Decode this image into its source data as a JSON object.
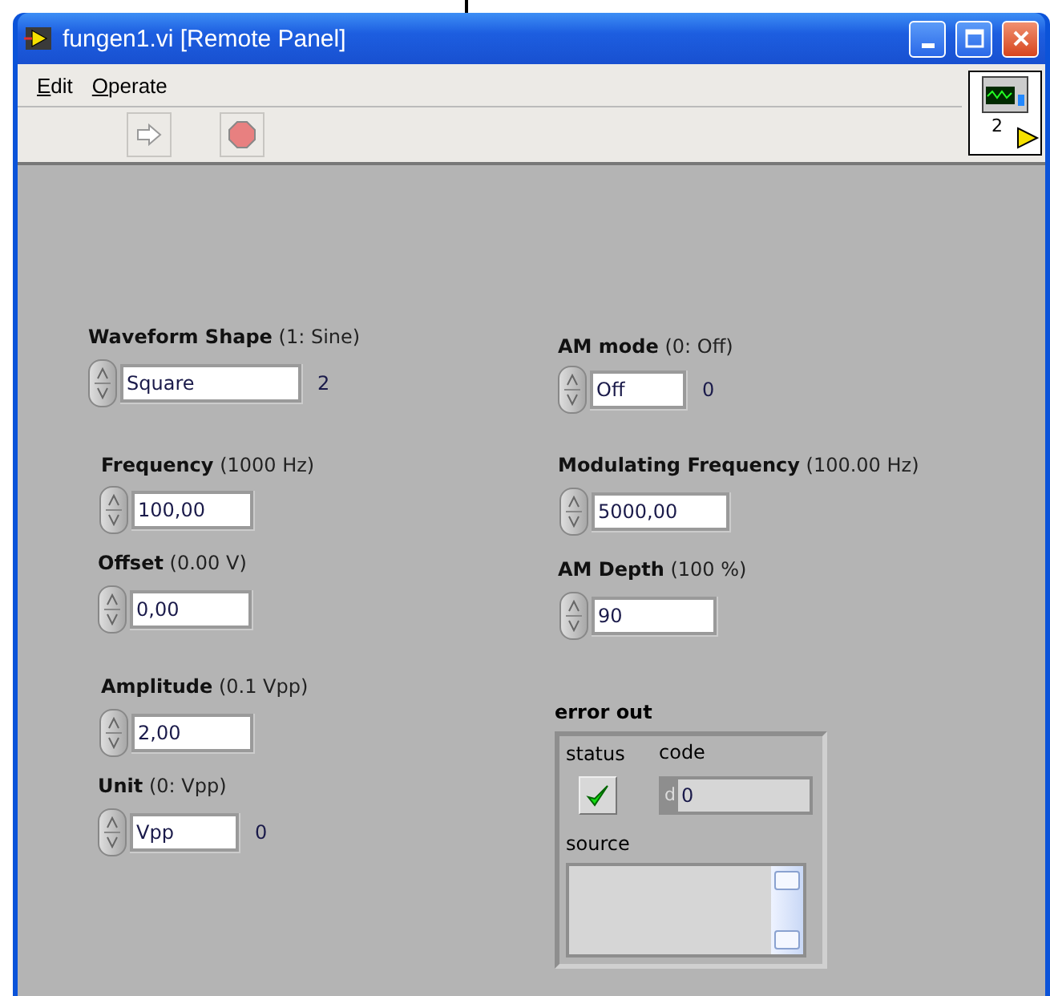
{
  "window": {
    "title": "fungen1.vi [Remote Panel]"
  },
  "menu": [
    {
      "label": "Edit"
    },
    {
      "label": "Operate"
    }
  ],
  "vi_icon": {
    "text": "2"
  },
  "controls": [
    {
      "kind": "ring",
      "label": "Waveform Shape",
      "hint": "(1: Sine)",
      "value": "Square",
      "index": "2"
    },
    {
      "kind": "numeric",
      "label": "Frequency",
      "hint": "(1000 Hz)",
      "value": "100,00"
    },
    {
      "kind": "numeric",
      "label": "Offset",
      "hint": "(0.00 V)",
      "value": "0,00"
    },
    {
      "kind": "numeric",
      "label": "Amplitude",
      "hint": "(0.1 Vpp)",
      "value": "2,00"
    },
    {
      "kind": "ring",
      "label": "Unit",
      "hint": "(0: Vpp)",
      "value": "Vpp",
      "index": "0"
    },
    {
      "kind": "ring",
      "label": "AM mode",
      "hint": "(0: Off)",
      "value": "Off",
      "index": "0"
    },
    {
      "kind": "numeric",
      "label": "Modulating Frequency",
      "hint": "(100.00  Hz)",
      "value": "5000,00"
    },
    {
      "kind": "numeric",
      "label": "AM Depth",
      "hint": "(100 %)",
      "value": "90"
    }
  ],
  "error_out": {
    "label": "error out",
    "status": {
      "label": "status",
      "ok": true
    },
    "code": {
      "label": "code",
      "radix": "d",
      "value": "0"
    },
    "source": {
      "label": "source"
    }
  }
}
